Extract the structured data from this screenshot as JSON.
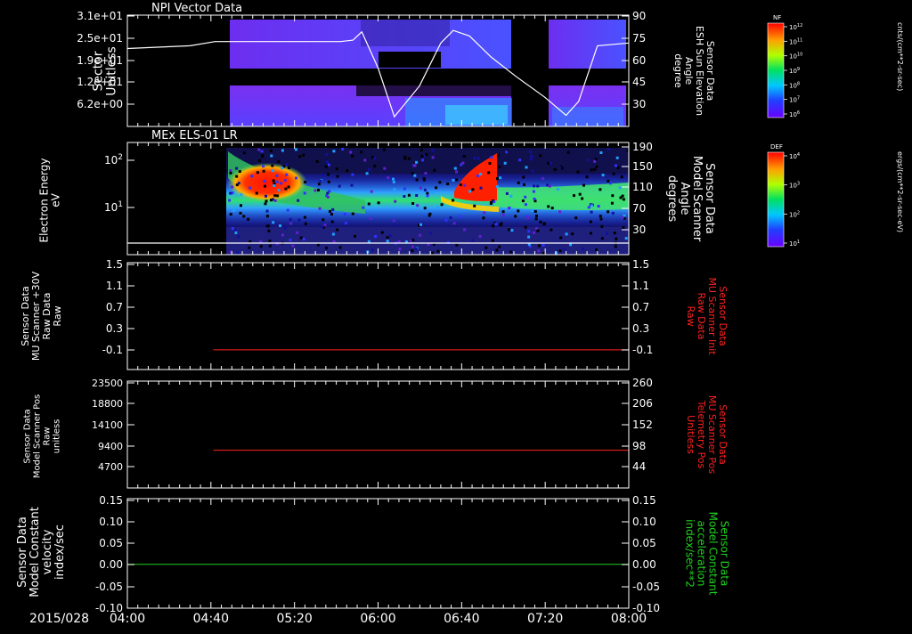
{
  "date_label": "2015/028",
  "time_ticks": [
    "04:00",
    "04:40",
    "05:20",
    "06:00",
    "06:40",
    "07:20",
    "08:00"
  ],
  "colors": {
    "grid": "#ffffff",
    "red": "#ff2020",
    "green": "#20d020"
  },
  "colorbars": [
    {
      "title": "NF",
      "unit": "cnts/(cm**2-sr-sec)",
      "tick_labels": [
        "10^12",
        "10^11",
        "10^10",
        "10^9",
        "10^8",
        "10^7",
        "10^6"
      ]
    },
    {
      "title": "DEF",
      "unit": "ergs/(cm**2-sr-sec-eV)",
      "tick_labels": [
        "10^4",
        "10^3",
        "10^2",
        "10^1"
      ]
    }
  ],
  "chart_data": [
    {
      "type": "heatmap",
      "title": "NPI Vector Data",
      "ylabel_lines": [
        "Sector",
        "Unitless"
      ],
      "y_ticks": [
        "3.1e+01",
        "2.5e+01",
        "1.9e+01",
        "1.2e+01",
        "6.2e+00"
      ],
      "y2label_lines": [
        "Sensor Data",
        "ESH Sun Elevation",
        "Angle",
        "degree"
      ],
      "y2_ticks": [
        "90",
        "75",
        "60",
        "45",
        "30"
      ],
      "y2lim": [
        10,
        90
      ],
      "overlay_line": {
        "name": "ESH Sun Elevation Angle",
        "x_hours": [
          4.0,
          4.5,
          4.7,
          5.4,
          5.7,
          5.8,
          5.87,
          6.0,
          6.13,
          6.33,
          6.5,
          6.6,
          6.73,
          6.9,
          7.1,
          7.33,
          7.5,
          7.6,
          7.75,
          8.0
        ],
        "y": [
          66,
          68,
          71,
          71,
          71,
          72,
          78,
          52,
          17,
          39,
          70,
          79,
          75,
          60,
          46,
          31,
          18,
          28,
          68,
          70
        ]
      }
    },
    {
      "type": "heatmap",
      "title": "MEx ELS-01 LR",
      "ylabel_lines": [
        "Electron Energy",
        "eV"
      ],
      "y_ticks": [
        "10^2",
        "10^1"
      ],
      "y2label_lines": [
        "Sensor Data",
        "Model Scanner",
        "Angle",
        "degrees"
      ],
      "y2_ticks": [
        "190",
        "150",
        "110",
        "70",
        "30"
      ],
      "overlay_line": {
        "name": "Model Scanner Angle",
        "y": 10
      }
    },
    {
      "type": "line",
      "ylabel_lines": [
        "Sensor Data",
        "MU Scanner +30V",
        "Raw Data",
        "Raw"
      ],
      "y_ticks": [
        "1.5",
        "1.1",
        "0.7",
        "0.3",
        "-0.1"
      ],
      "y2label_lines": [
        "Sensor Data",
        "MU Scanner Init",
        "Raw Data",
        "Raw"
      ],
      "y2_ticks": [
        "1.5",
        "1.1",
        "0.7",
        "0.3",
        "-0.1"
      ],
      "ylim": [
        -0.4,
        1.5
      ],
      "series": [
        {
          "x_start_hours": 4.7,
          "x_end_hours": 8.0,
          "y": -0.05
        }
      ]
    },
    {
      "type": "line",
      "ylabel_lines": [
        "Sensor Data",
        "Model Scanner Pos",
        "Raw",
        "unitless"
      ],
      "y_ticks": [
        "23500",
        "18800",
        "14100",
        "9400",
        "4700"
      ],
      "y2label_lines": [
        "Sensor Data",
        "MU Scanner Pos",
        "Telemetry Pos",
        "Unitless"
      ],
      "y2_ticks": [
        "260",
        "206",
        "152",
        "98",
        "44"
      ],
      "ylim": [
        0,
        23500
      ],
      "series": [
        {
          "x_start_hours": 4.7,
          "x_end_hours": 8.0,
          "y": 8300
        }
      ]
    },
    {
      "type": "line",
      "ylabel_lines": [
        "Sensor Data",
        "Model Constant",
        "velocity",
        "index/sec"
      ],
      "y_ticks": [
        "0.15",
        "0.10",
        "0.05",
        "0.00",
        "-0.05",
        "-0.10"
      ],
      "y2label_lines": [
        "Sensor Data",
        "Model Constant",
        "acceleration",
        "index/sec**2"
      ],
      "y2_ticks": [
        "0.15",
        "0.10",
        "0.05",
        "0.00",
        "-0.05",
        "-0.10"
      ],
      "ylim": [
        -0.1,
        0.15
      ],
      "series": [
        {
          "x_start_hours": 4.0,
          "x_end_hours": 8.0,
          "y": 0.0
        }
      ]
    }
  ]
}
